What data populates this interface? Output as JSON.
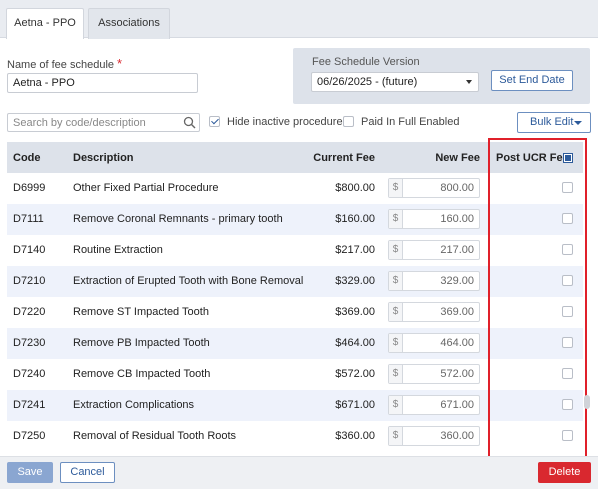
{
  "tabs": [
    {
      "label": "Aetna - PPO",
      "active": true
    },
    {
      "label": "Associations",
      "active": false
    }
  ],
  "form": {
    "name_label": "Name of fee schedule",
    "required_mark": "*",
    "name_value": "Aetna - PPO"
  },
  "version": {
    "label": "Fee Schedule Version",
    "selected": "06/26/2025 - (future)",
    "set_end_date_label": "Set End Date"
  },
  "toolbar": {
    "search_placeholder": "Search by code/description",
    "hide_inactive_label": "Hide inactive procedures",
    "hide_inactive_checked": true,
    "paid_in_full_label": "Paid In Full Enabled",
    "paid_in_full_checked": false,
    "bulk_edit_label": "Bulk Edit"
  },
  "table": {
    "headers": {
      "code": "Code",
      "description": "Description",
      "current_fee": "Current Fee",
      "new_fee": "New Fee",
      "post_ucr": "Post UCR Fee"
    },
    "currency_prefix": "$",
    "rows": [
      {
        "code": "D6999",
        "description": "Other Fixed Partial Procedure",
        "current_fee": "$800.00",
        "new_fee": "800.00"
      },
      {
        "code": "D7111",
        "description": "Remove Coronal Remnants - primary tooth",
        "current_fee": "$160.00",
        "new_fee": "160.00"
      },
      {
        "code": "D7140",
        "description": "Routine Extraction",
        "current_fee": "$217.00",
        "new_fee": "217.00"
      },
      {
        "code": "D7210",
        "description": "Extraction of Erupted Tooth with Bone Removal",
        "current_fee": "$329.00",
        "new_fee": "329.00"
      },
      {
        "code": "D7220",
        "description": "Remove ST Impacted Tooth",
        "current_fee": "$369.00",
        "new_fee": "369.00"
      },
      {
        "code": "D7230",
        "description": "Remove PB Impacted Tooth",
        "current_fee": "$464.00",
        "new_fee": "464.00"
      },
      {
        "code": "D7240",
        "description": "Remove CB Impacted Tooth",
        "current_fee": "$572.00",
        "new_fee": "572.00"
      },
      {
        "code": "D7241",
        "description": "Extraction Complications",
        "current_fee": "$671.00",
        "new_fee": "671.00"
      },
      {
        "code": "D7250",
        "description": "Removal of Residual Tooth Roots",
        "current_fee": "$360.00",
        "new_fee": "360.00"
      }
    ]
  },
  "footer": {
    "save_label": "Save",
    "cancel_label": "Cancel",
    "delete_label": "Delete"
  },
  "colors": {
    "accent": "#2c5a9a",
    "delete": "#d9282f",
    "highlight": "#e0202a",
    "alt_row": "#eef2fb",
    "header_bg": "#dde2ea"
  }
}
